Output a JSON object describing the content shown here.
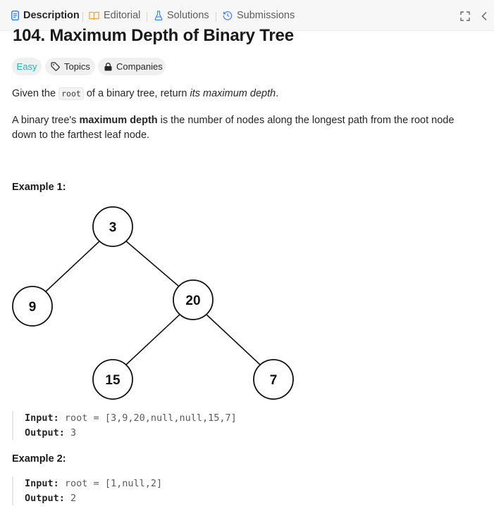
{
  "tabs": [
    {
      "label": "Description",
      "icon": "description-icon",
      "active": true
    },
    {
      "label": "Editorial",
      "icon": "book-icon",
      "accent": "#f5a623"
    },
    {
      "label": "Solutions",
      "icon": "flask-icon",
      "accent": "#3b82f6"
    },
    {
      "label": "Submissions",
      "icon": "history-icon",
      "accent": "#3b82f6"
    }
  ],
  "problem": {
    "title": "104. Maximum Depth of Binary Tree",
    "difficulty": "Easy",
    "difficulty_color": "#1cb8b8",
    "topics_label": "Topics",
    "companies_label": "Companies"
  },
  "description": {
    "p1_before": "Given the ",
    "p1_code": "root",
    "p1_mid": " of a binary tree, return ",
    "p1_italic": "its maximum depth",
    "p1_after": ".",
    "p2_before": "A binary tree's ",
    "p2_bold": "maximum depth",
    "p2_after": " is the number of nodes along the longest path from the root node down to the farthest leaf node."
  },
  "example1": {
    "heading": "Example 1:",
    "tree_nodes": [
      "3",
      "9",
      "20",
      "15",
      "7"
    ],
    "input_label": "Input:",
    "input_value": "root = [3,9,20,null,null,15,7]",
    "output_label": "Output:",
    "output_value": "3"
  },
  "example2": {
    "heading": "Example 2:",
    "input_label": "Input:",
    "input_value": "root = [1,null,2]",
    "output_label": "Output:",
    "output_value": "2"
  }
}
